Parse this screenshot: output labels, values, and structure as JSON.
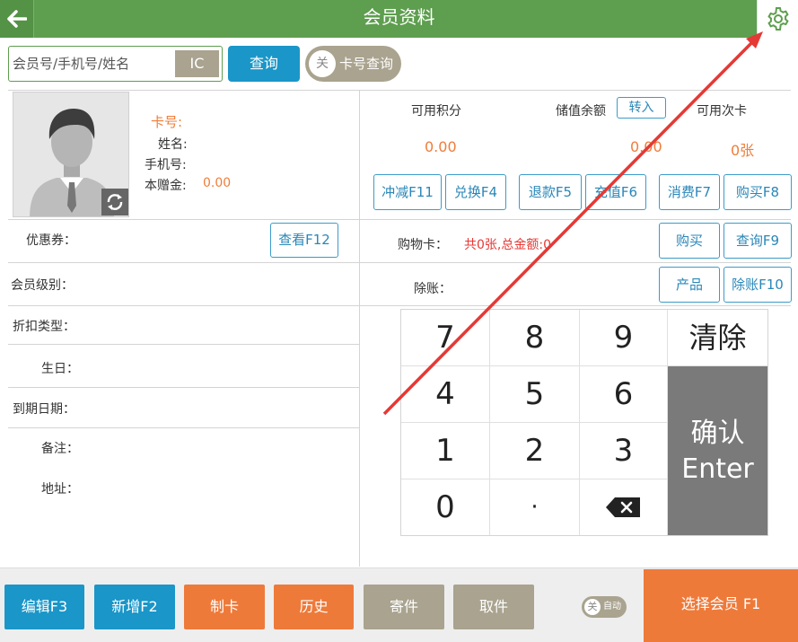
{
  "header": {
    "title": "会员资料",
    "back_icon": "arrow-left-icon",
    "settings_icon": "gear-icon"
  },
  "search": {
    "placeholder": "会员号/手机号/姓名",
    "ic_label": "IC",
    "query_label": "查询",
    "toggle_state": "关",
    "toggle_label": "卡号查询"
  },
  "member": {
    "card_label": "卡号:",
    "name_label": "姓名:",
    "phone_label": "手机号:",
    "gift_label": "本赠金:",
    "gift_value": "0.00"
  },
  "stats": {
    "points_label": "可用积分",
    "points_value": "0.00",
    "balance_label": "储值余额",
    "transfer_label": "转入",
    "balance_value": "0.00",
    "times_label": "可用次卡",
    "times_value": "0张"
  },
  "actions": [
    "冲减F11",
    "兑换F4",
    "退款F5",
    "充值F6",
    "消费F7",
    "购买F8"
  ],
  "fields": {
    "coupon_label": "优惠券：",
    "coupon_view": "查看F12",
    "level_label": "会员级别：",
    "discount_label": "折扣类型：",
    "birthday_label": "生日：",
    "expiry_label": "到期日期：",
    "note_label": "备注：",
    "address_label": "地址："
  },
  "shopping": {
    "label": "购物卡：",
    "value": "共0张,总金额:0",
    "buy": "购买",
    "query": "查询F9",
    "credit_label": "除账：",
    "product": "产品",
    "credit_btn": "除账F10"
  },
  "keypad": {
    "keys": [
      "7",
      "8",
      "9",
      "4",
      "5",
      "6",
      "1",
      "2",
      "3",
      "0",
      "·"
    ],
    "clear": "清除",
    "confirm": "确认",
    "enter": "Enter",
    "backspace_icon": "backspace-icon"
  },
  "footer": {
    "edit": "编辑F3",
    "new": "新增F2",
    "make_card": "制卡",
    "history": "历史",
    "deposit": "寄件",
    "pickup": "取件",
    "auto_state": "关",
    "auto_label": "自动",
    "select_member": "选择会员 F1"
  },
  "colors": {
    "header": "#5e9e4f",
    "blue": "#1a96c8",
    "orange": "#ee7a3a",
    "khaki": "#a9a38f",
    "annotation_arrow": "#e53935"
  }
}
